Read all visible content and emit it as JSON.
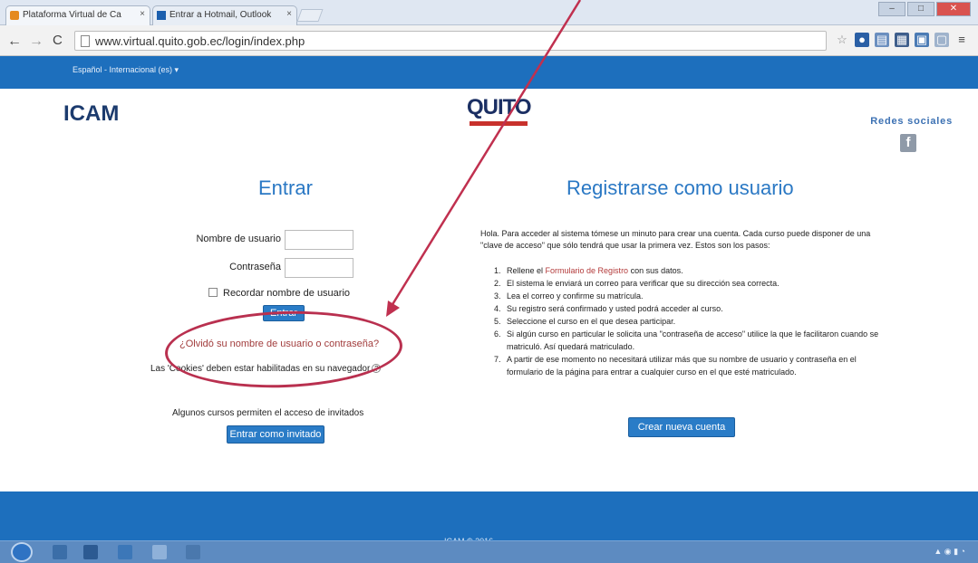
{
  "browser": {
    "tabs": [
      {
        "label": "Plataforma Virtual de Ca",
        "active": true
      },
      {
        "label": "Entrar a Hotmail, Outlook",
        "active": false
      }
    ],
    "address": "www.virtual.quito.gob.ec/login/index.php"
  },
  "site": {
    "language": "Español - Internacional (es) ▾",
    "logo": "ICAM",
    "quito_logo": "QUITO",
    "social_title": "Redes sociales",
    "social_icon": "f"
  },
  "login": {
    "title": "Entrar",
    "username_label": "Nombre de usuario",
    "password_label": "Contraseña",
    "remember_label": "Recordar nombre de usuario",
    "enter_button": "Entrar",
    "forgot_link": "¿Olvidó su nombre de usuario o contraseña?",
    "cookies_text": "Las 'Cookies' deben estar habilitadas en su navegador",
    "guest_note": "Algunos cursos permiten el acceso de invitados",
    "guest_button": "Entrar como invitado"
  },
  "signup": {
    "title": "Registrarse como usuario",
    "intro": "Hola. Para acceder al sistema tómese un minuto para crear una cuenta. Cada curso puede disponer de una \"clave de acceso\" que sólo tendrá que usar la primera vez. Estos son los pasos:",
    "steps": [
      {
        "num": "1.",
        "pre": "Rellene el ",
        "link": "Formulario de Registro",
        "post": " con sus datos."
      },
      {
        "num": "2.",
        "pre": "El sistema le enviará un correo para verificar que su dirección sea correcta.",
        "link": "",
        "post": ""
      },
      {
        "num": "3.",
        "pre": "Lea el correo y confirme su matrícula.",
        "link": "",
        "post": ""
      },
      {
        "num": "4.",
        "pre": "Su registro será confirmado y usted podrá acceder al curso.",
        "link": "",
        "post": ""
      },
      {
        "num": "5.",
        "pre": "Seleccione el curso en el que desea participar.",
        "link": "",
        "post": ""
      },
      {
        "num": "6.",
        "pre": "Si algún curso en particular le solicita una \"contraseña de acceso\" utilice la que le facilitaron cuando se matriculó. Así quedará matriculado.",
        "link": "",
        "post": ""
      },
      {
        "num": "7.",
        "pre": "A partir de ese momento no necesitará utilizar más que su nombre de usuario y contraseña en el formulario de la página para entrar a cualquier curso en el que esté matriculado.",
        "link": "",
        "post": ""
      }
    ],
    "create_button": "Crear nueva cuenta"
  },
  "footer": {
    "text": "ICAM © 2016"
  },
  "colors": {
    "brand_blue": "#1d6fbd",
    "title_blue": "#2a78c4",
    "annotation_red": "#b9304f"
  }
}
